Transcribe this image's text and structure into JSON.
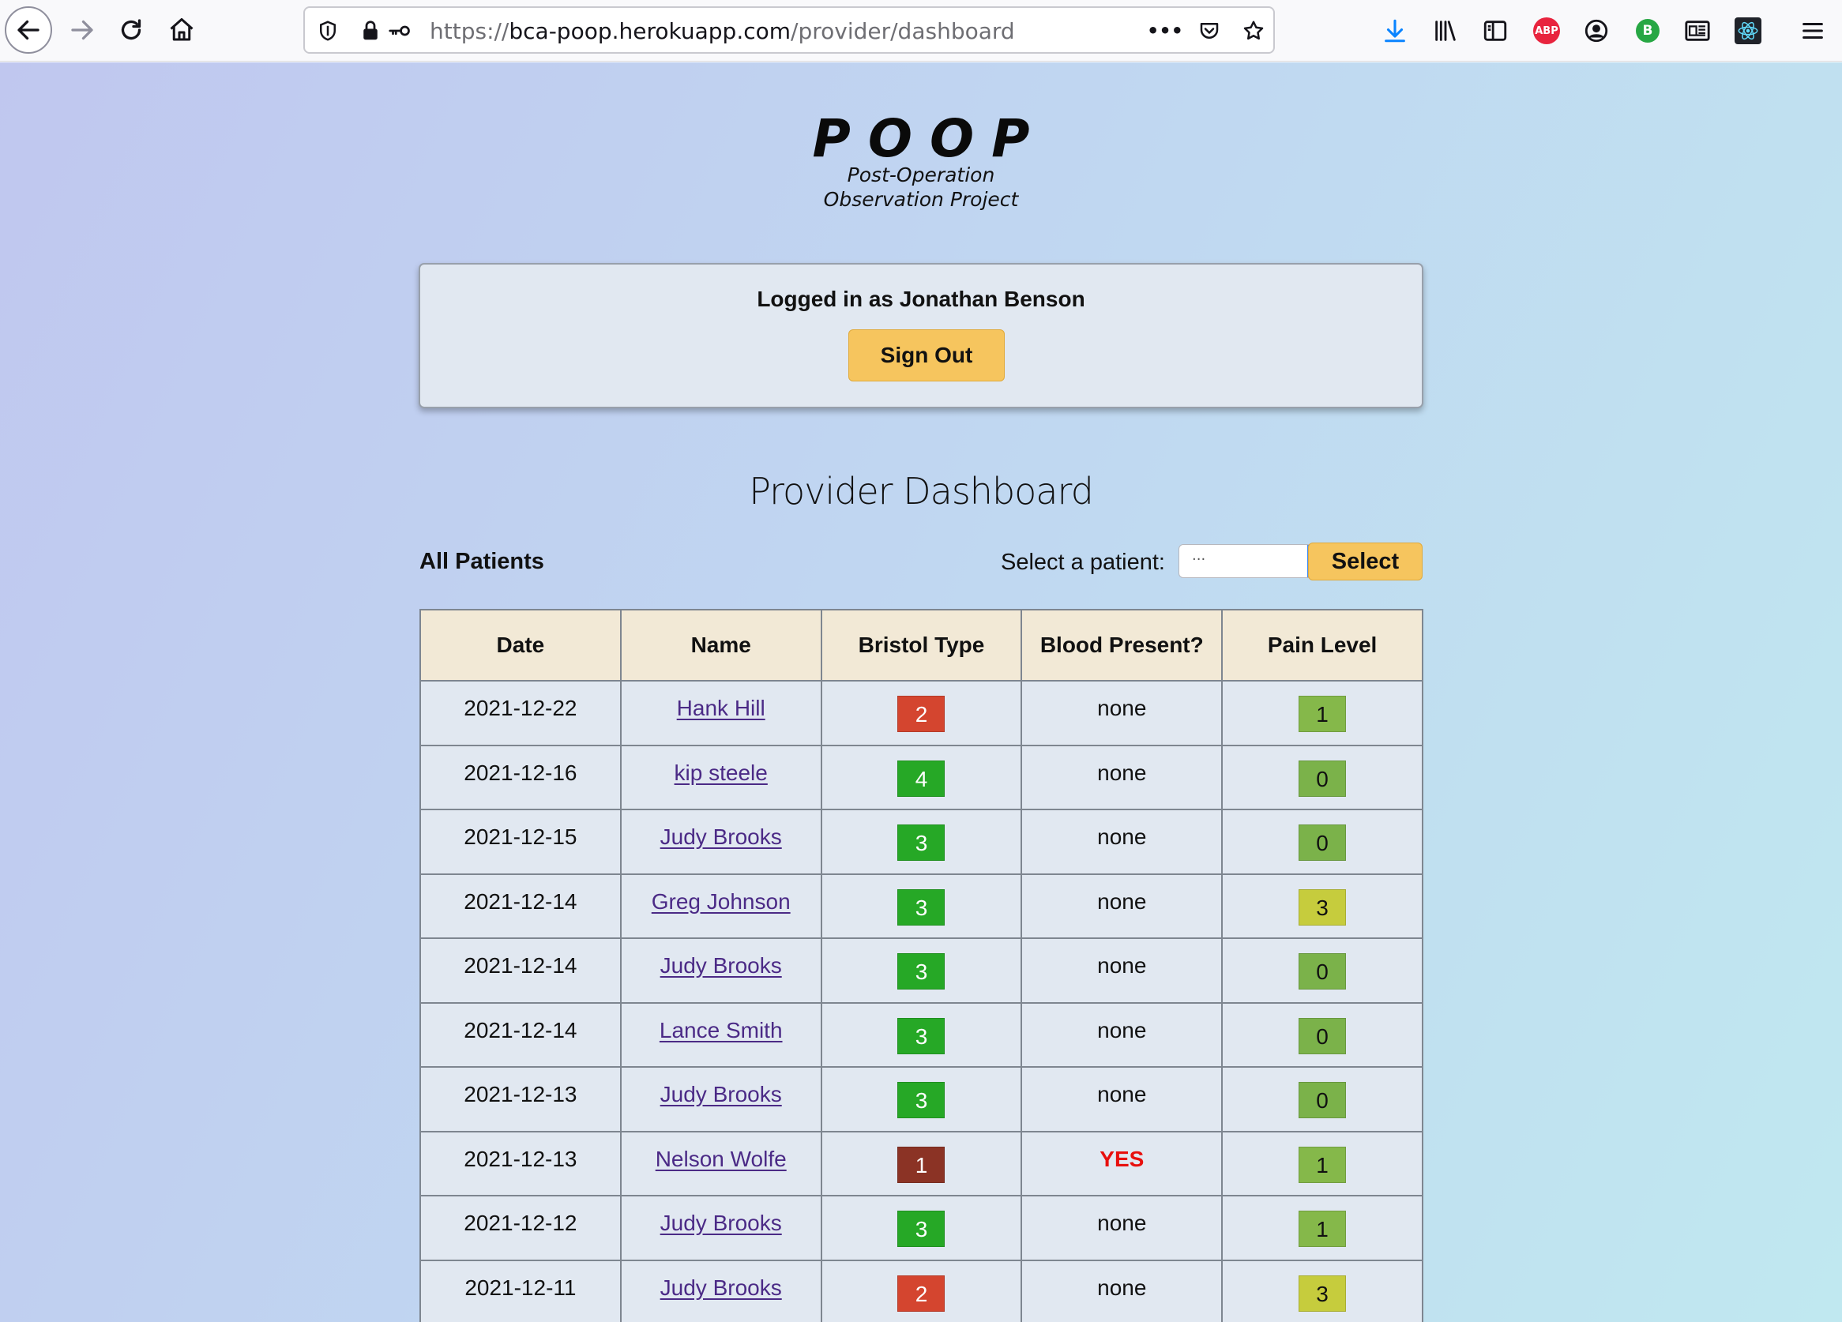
{
  "browser": {
    "url_prefix": "https://",
    "url_host": "bca-poop.herokuapp.com",
    "url_path": "/provider/dashboard",
    "more_label": "•••",
    "abp_label": "ABP",
    "profile_badge_label": "B"
  },
  "logo": {
    "title": "POOP",
    "subtitle_line1": "Post-Operation",
    "subtitle_line2": "Observation Project"
  },
  "login": {
    "status_text": "Logged in as Jonathan Benson",
    "signout_label": "Sign Out"
  },
  "dashboard": {
    "title": "Provider Dashboard",
    "all_patients_label": "All Patients",
    "select_label": "Select a patient:",
    "select_value": "···",
    "select_button": "Select"
  },
  "colors": {
    "bristol_1": "#8b3325",
    "bristol_2": "#d4452f",
    "bristol_3": "#26a826",
    "bristol_4": "#26a826",
    "pain_0": "#7bb24a",
    "pain_1": "#85b84a",
    "pain_3": "#c6cc3d",
    "blood_yes": "#e8100e"
  },
  "table": {
    "headers": [
      "Date",
      "Name",
      "Bristol Type",
      "Blood Present?",
      "Pain Level"
    ],
    "rows": [
      {
        "date": "2021-12-22",
        "name": "Hank Hill",
        "bristol": "2",
        "blood": "none",
        "pain": "1"
      },
      {
        "date": "2021-12-16",
        "name": "kip steele",
        "bristol": "4",
        "blood": "none",
        "pain": "0"
      },
      {
        "date": "2021-12-15",
        "name": "Judy Brooks",
        "bristol": "3",
        "blood": "none",
        "pain": "0"
      },
      {
        "date": "2021-12-14",
        "name": "Greg Johnson",
        "bristol": "3",
        "blood": "none",
        "pain": "3"
      },
      {
        "date": "2021-12-14",
        "name": "Judy Brooks",
        "bristol": "3",
        "blood": "none",
        "pain": "0"
      },
      {
        "date": "2021-12-14",
        "name": "Lance Smith",
        "bristol": "3",
        "blood": "none",
        "pain": "0"
      },
      {
        "date": "2021-12-13",
        "name": "Judy Brooks",
        "bristol": "3",
        "blood": "none",
        "pain": "0"
      },
      {
        "date": "2021-12-13",
        "name": "Nelson Wolfe",
        "bristol": "1",
        "blood": "YES",
        "pain": "1"
      },
      {
        "date": "2021-12-12",
        "name": "Judy Brooks",
        "bristol": "3",
        "blood": "none",
        "pain": "1"
      },
      {
        "date": "2021-12-11",
        "name": "Judy Brooks",
        "bristol": "2",
        "blood": "none",
        "pain": "3"
      }
    ]
  }
}
